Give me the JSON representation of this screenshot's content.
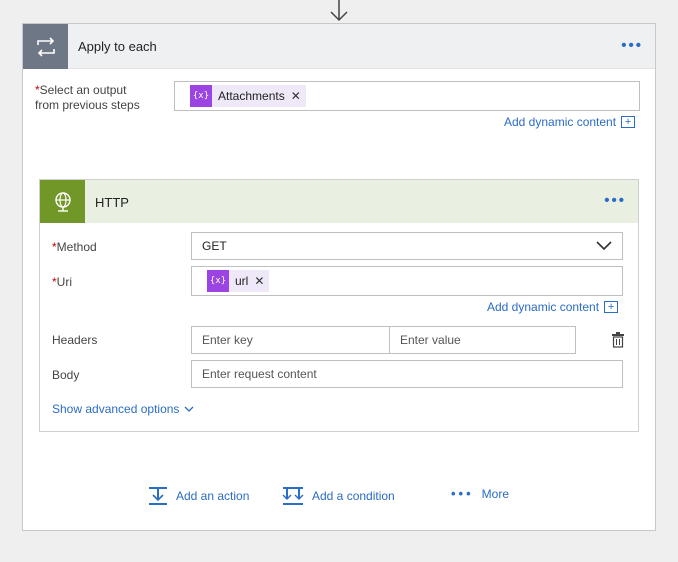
{
  "outer": {
    "title": "Apply to each",
    "select_label_line1": "Select an output",
    "select_label_line2": "from previous steps",
    "token_label": "Attachments",
    "token_symbol": "{x}",
    "add_dynamic": "Add dynamic content",
    "plus": "+"
  },
  "http": {
    "title": "HTTP",
    "method_label": "Method",
    "method_value": "GET",
    "uri_label": "Uri",
    "uri_token": "url",
    "token_symbol": "{x}",
    "add_dynamic": "Add dynamic content",
    "plus": "+",
    "headers_label": "Headers",
    "key_placeholder": "Enter key",
    "value_placeholder": "Enter value",
    "body_label": "Body",
    "body_placeholder": "Enter request content",
    "advanced_label": "Show advanced options"
  },
  "footer": {
    "add_action": "Add an action",
    "add_condition": "Add a condition",
    "more": "More"
  },
  "colors": {
    "accent": "#2b6cc4",
    "loop_icon_bg": "#6e7785",
    "http_icon_bg": "#709727",
    "token_icon_bg": "#9b44e3",
    "required": "#cc0000"
  }
}
